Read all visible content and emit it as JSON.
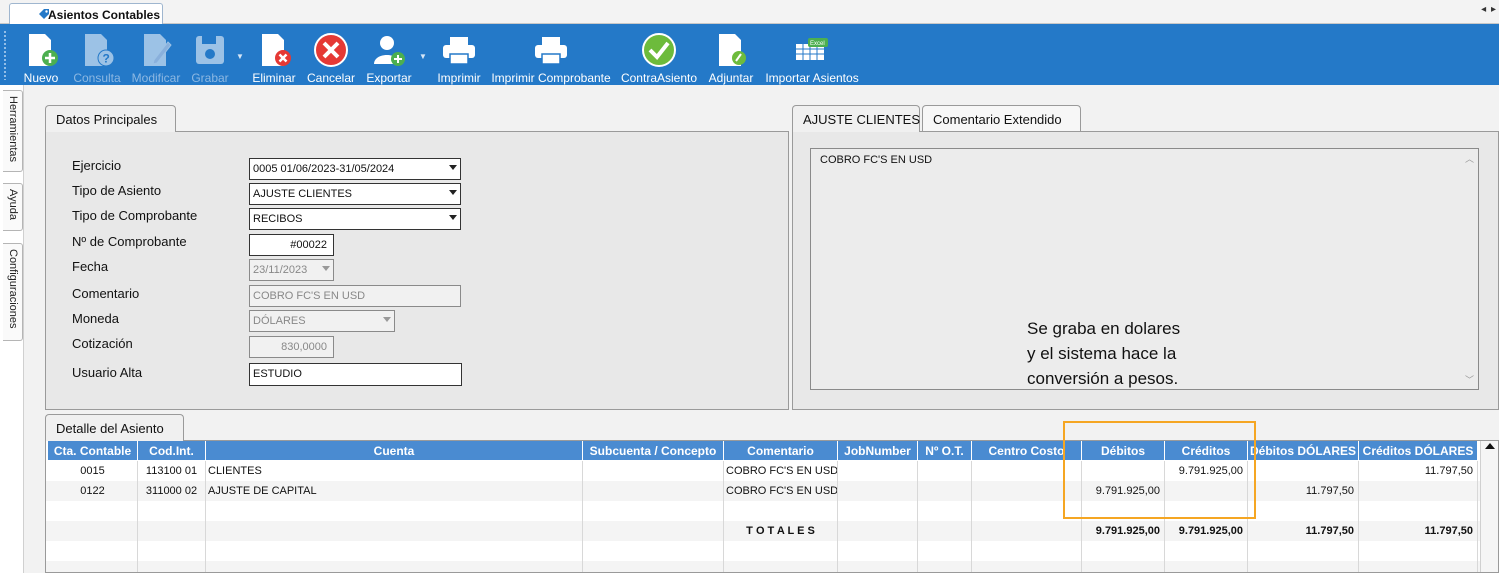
{
  "window": {
    "tab_title": "Asientos Contables",
    "nav_arrows": "◂ ▸"
  },
  "toolbar": {
    "buttons": [
      {
        "label": "Nuevo",
        "icon": "new-document-icon",
        "enabled": true
      },
      {
        "label": "Consulta",
        "icon": "query-document-icon",
        "enabled": false
      },
      {
        "label": "Modificar",
        "icon": "edit-document-icon",
        "enabled": false
      },
      {
        "label": "Grabar",
        "icon": "save-disk-icon",
        "enabled": false
      },
      {
        "label": "Eliminar",
        "icon": "delete-document-icon",
        "enabled": true
      },
      {
        "label": "Cancelar",
        "icon": "cancel-icon",
        "enabled": true
      },
      {
        "label": "Exportar",
        "icon": "export-user-icon",
        "enabled": true
      },
      {
        "label": "Imprimir",
        "icon": "printer-icon",
        "enabled": true
      },
      {
        "label": "Imprimir Comprobante",
        "icon": "printer-icon",
        "enabled": true
      },
      {
        "label": "ContraAsiento",
        "icon": "check-icon",
        "enabled": true
      },
      {
        "label": "Adjuntar",
        "icon": "attach-document-icon",
        "enabled": true
      },
      {
        "label": "Importar Asientos",
        "icon": "excel-import-icon",
        "enabled": true
      }
    ],
    "excel_badge": "Excel"
  },
  "side_tabs": [
    "Herramientas",
    "Ayuda",
    "Configuraciones"
  ],
  "datos": {
    "tab": "Datos Principales",
    "fields": {
      "ejercicio": {
        "label": "Ejercicio",
        "value": "0005 01/06/2023-31/05/2024"
      },
      "tipo_asiento": {
        "label": "Tipo de Asiento",
        "value": "AJUSTE CLIENTES"
      },
      "tipo_comprobante": {
        "label": "Tipo de Comprobante",
        "value": "RECIBOS"
      },
      "nro_comprobante": {
        "label": "Nº de Comprobante",
        "value": "#00022"
      },
      "fecha": {
        "label": "Fecha",
        "value": "23/11/2023"
      },
      "comentario": {
        "label": "Comentario",
        "value": "COBRO FC'S EN USD"
      },
      "moneda": {
        "label": "Moneda",
        "value": "DÓLARES"
      },
      "cotizacion": {
        "label": "Cotización",
        "value": "830,0000"
      },
      "usuario_alta": {
        "label": "Usuario Alta",
        "value": "ESTUDIO"
      }
    }
  },
  "comments": {
    "tabs": [
      "AJUSTE CLIENTES",
      "Comentario Extendido"
    ],
    "text": "COBRO FC'S EN USD"
  },
  "annotation": {
    "lines": [
      "Se graba en dolares",
      "y el sistema hace la",
      "conversión a pesos."
    ],
    "color": "#f5a623"
  },
  "detalle": {
    "tab": "Detalle del Asiento",
    "columns": [
      "Cta. Contable",
      "Cod.Int.",
      "Cuenta",
      "Subcuenta / Concepto",
      "Comentario",
      "JobNumber",
      "Nº O.T.",
      "Centro Costo",
      "Débitos",
      "Créditos",
      "Débitos DÓLARES",
      "Créditos DÓLARES"
    ],
    "rows": [
      [
        "0015",
        "113100 01",
        "CLIENTES",
        "",
        "COBRO FC'S EN USD",
        "",
        "",
        "",
        "",
        "9.791.925,00",
        "",
        "11.797,50"
      ],
      [
        "0122",
        "311000 02",
        "AJUSTE DE CAPITAL",
        "",
        "COBRO FC'S EN USD",
        "",
        "",
        "",
        "9.791.925,00",
        "",
        "11.797,50",
        ""
      ],
      [
        "",
        "",
        "",
        "",
        "",
        "",
        "",
        "",
        "",
        "",
        "",
        ""
      ],
      [
        "",
        "",
        "",
        "",
        "T O T A L E S",
        "",
        "",
        "",
        "9.791.925,00",
        "9.791.925,00",
        "11.797,50",
        "11.797,50"
      ],
      [
        "",
        "",
        "",
        "",
        "",
        "",
        "",
        "",
        "",
        "",
        "",
        ""
      ],
      [
        "",
        "",
        "",
        "",
        "",
        "",
        "",
        "",
        "",
        "",
        "",
        ""
      ]
    ]
  },
  "colors": {
    "toolbar": "#2479c8",
    "grid_header": "#4a8bd1",
    "highlight": "#f5a623"
  }
}
